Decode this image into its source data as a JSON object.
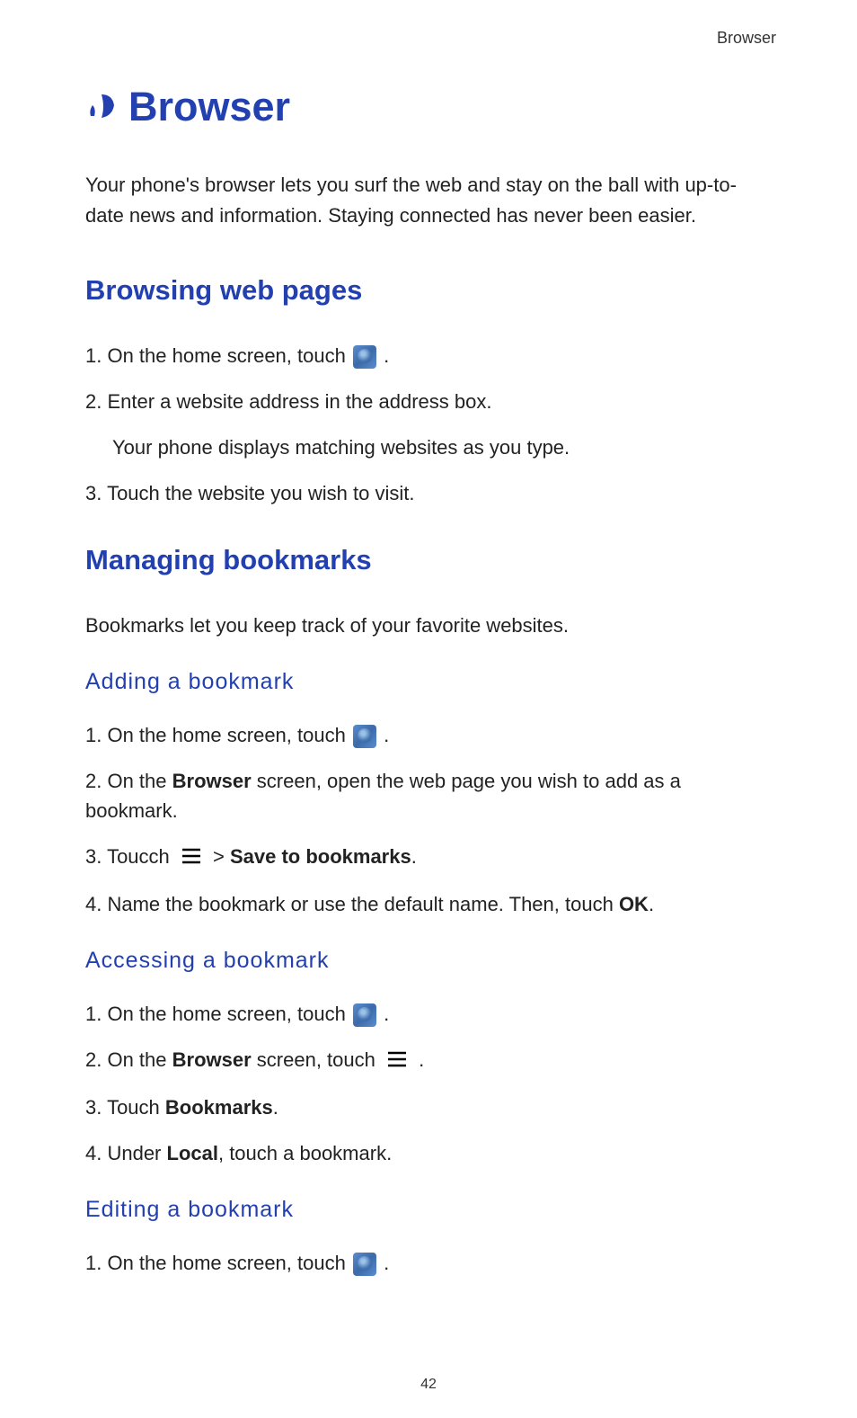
{
  "header": {
    "label": "Browser"
  },
  "title": "Browser",
  "intro": "Your phone's browser lets you surf the web and stay on the ball with up-to-date news and information. Staying connected has never been easier.",
  "sections": {
    "browsing": {
      "heading": "Browsing web pages",
      "steps": {
        "s1": "1. On the home screen, touch ",
        "s1_period": " .",
        "s2": "2. Enter a website address in the address box.",
        "s2_sub": "Your phone displays matching websites as you type.",
        "s3": "3. Touch the website you wish to visit."
      }
    },
    "managing": {
      "heading": "Managing bookmarks",
      "intro": "Bookmarks let you keep track of your favorite websites.",
      "adding": {
        "heading": "Adding  a  bookmark",
        "s1": "1. On the home screen, touch ",
        "s1_period": " .",
        "s2_a": "2. On the ",
        "s2_bold": "Browser",
        "s2_b": " screen, open the web page you wish to add as a bookmark.",
        "s3_a": "3. Toucch ",
        "s3_gt": "  > ",
        "s3_bold": "Save to bookmarks",
        "s3_period": ".",
        "s4_a": "4. Name the bookmark or use the default name. Then, touch ",
        "s4_bold": "OK",
        "s4_period": "."
      },
      "accessing": {
        "heading": "Accessing  a  bookmark",
        "s1": "1. On the home screen, touch ",
        "s1_period": " .",
        "s2_a": "2. On the ",
        "s2_bold": "Browser",
        "s2_b": " screen, touch ",
        "s2_period": " .",
        "s3_a": "3. Touch ",
        "s3_bold": "Bookmarks",
        "s3_period": ".",
        "s4_a": "4. Under ",
        "s4_bold": "Local",
        "s4_b": ", touch a bookmark."
      },
      "editing": {
        "heading": "Editing  a  bookmark",
        "s1": "1. On the home screen, touch ",
        "s1_period": " ."
      }
    }
  },
  "page_number": "42"
}
